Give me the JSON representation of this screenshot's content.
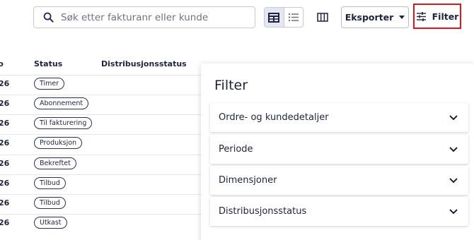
{
  "search": {
    "placeholder": "Søk etter fakturanr eller kunde",
    "icon": "search-icon"
  },
  "toolbar": {
    "export_label": "Eksporter",
    "filter_label": "Filter",
    "view_modes": [
      "table-view-icon",
      "list-view-icon"
    ],
    "active_view": "table-view-icon"
  },
  "table": {
    "columns": {
      "date": "to",
      "status": "Status",
      "distribution": "Distribusjonsstatus"
    },
    "rows": [
      {
        "date": "26",
        "status": "Timer"
      },
      {
        "date": "26",
        "status": "Abonnement"
      },
      {
        "date": "26",
        "status": "Til fakturering"
      },
      {
        "date": "26",
        "status": "Produksjon"
      },
      {
        "date": "26",
        "status": "Bekreftet"
      },
      {
        "date": "26",
        "status": "Tilbud"
      },
      {
        "date": "26",
        "status": "Tilbud"
      },
      {
        "date": "26",
        "status": "Utkast"
      }
    ]
  },
  "filter_panel": {
    "title": "Filter",
    "sections": [
      {
        "label": "Ordre- og kundedetaljer"
      },
      {
        "label": "Periode"
      },
      {
        "label": "Dimensjoner"
      },
      {
        "label": "Distribusjonsstatus"
      }
    ]
  },
  "colors": {
    "text": "#1f2340",
    "highlight_border": "#e2151b",
    "active_toggle": "#e4e6f3"
  }
}
